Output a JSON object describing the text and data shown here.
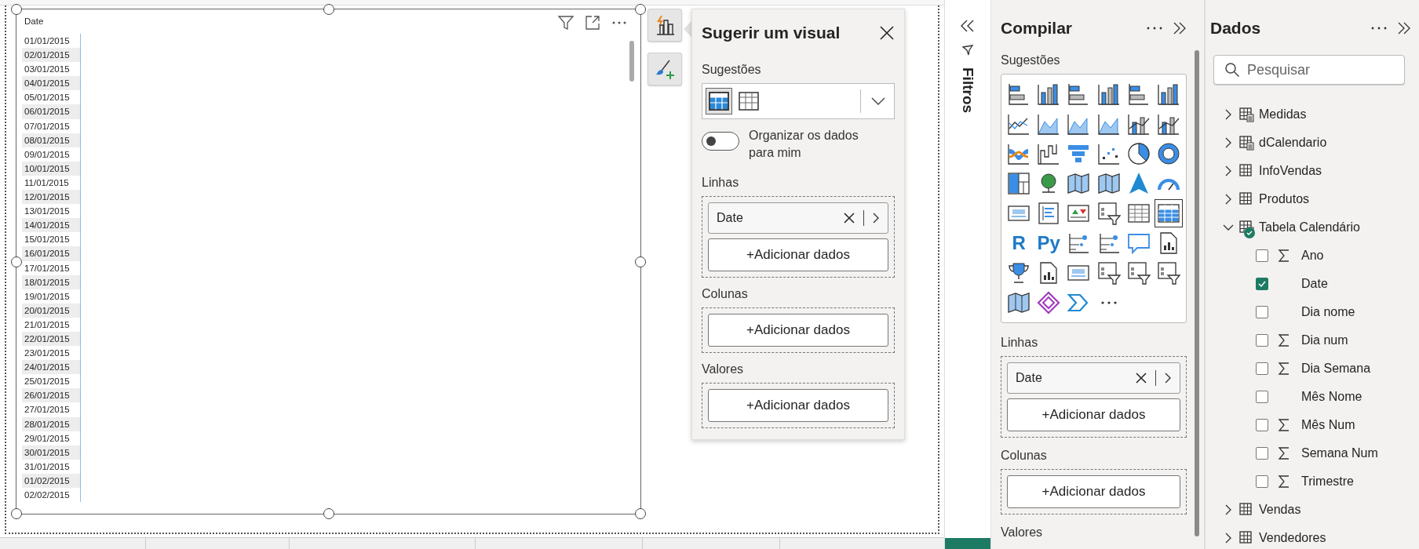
{
  "report_visual": {
    "header": "Date",
    "rows": [
      "01/01/2015",
      "02/01/2015",
      "03/01/2015",
      "04/01/2015",
      "05/01/2015",
      "06/01/2015",
      "07/01/2015",
      "08/01/2015",
      "09/01/2015",
      "10/01/2015",
      "11/01/2015",
      "12/01/2015",
      "13/01/2015",
      "14/01/2015",
      "15/01/2015",
      "16/01/2015",
      "17/01/2015",
      "18/01/2015",
      "19/01/2015",
      "20/01/2015",
      "21/01/2015",
      "22/01/2015",
      "23/01/2015",
      "24/01/2015",
      "25/01/2015",
      "26/01/2015",
      "27/01/2015",
      "28/01/2015",
      "29/01/2015",
      "30/01/2015",
      "31/01/2015",
      "01/02/2015",
      "02/02/2015"
    ]
  },
  "suggest_panel": {
    "title": "Sugerir um visual",
    "suggestions_label": "Sugestões",
    "suggestions": [
      {
        "kind": "matrix",
        "selected": true
      },
      {
        "kind": "table",
        "selected": false
      }
    ],
    "toggle": {
      "label": "Organizar os dados para mim",
      "on": false
    },
    "wells": [
      {
        "label": "Linhas",
        "fields": [
          "Date"
        ],
        "add": "+Adicionar dados"
      },
      {
        "label": "Colunas",
        "add": "+Adicionar dados"
      },
      {
        "label": "Valores",
        "add": "+Adicionar dados"
      }
    ]
  },
  "filters_pane": {
    "label": "Filtros"
  },
  "build_pane": {
    "title": "Compilar",
    "visuals_label": "Sugestões",
    "visuals": [
      {
        "kind": "hbar",
        "selected": false
      },
      {
        "kind": "column",
        "selected": false
      },
      {
        "kind": "hbar",
        "selected": false
      },
      {
        "kind": "column",
        "selected": false
      },
      {
        "kind": "hbar",
        "selected": false
      },
      {
        "kind": "column",
        "selected": false
      },
      {
        "kind": "line",
        "selected": false
      },
      {
        "kind": "area",
        "selected": false
      },
      {
        "kind": "area",
        "selected": false
      },
      {
        "kind": "area",
        "selected": false
      },
      {
        "kind": "combo",
        "selected": false
      },
      {
        "kind": "combo",
        "selected": false
      },
      {
        "kind": "ribbon",
        "selected": false
      },
      {
        "kind": "waterfall",
        "selected": false
      },
      {
        "kind": "funnel",
        "selected": false
      },
      {
        "kind": "scatter",
        "selected": false
      },
      {
        "kind": "pie",
        "selected": false
      },
      {
        "kind": "donut",
        "selected": false
      },
      {
        "kind": "treemap",
        "selected": false
      },
      {
        "kind": "globe",
        "selected": false
      },
      {
        "kind": "map",
        "selected": false
      },
      {
        "kind": "map",
        "selected": false
      },
      {
        "kind": "arrow",
        "selected": false
      },
      {
        "kind": "gauge",
        "selected": false
      },
      {
        "kind": "card",
        "selected": false
      },
      {
        "kind": "list",
        "selected": false
      },
      {
        "kind": "kpi",
        "selected": false
      },
      {
        "kind": "slicer",
        "selected": false
      },
      {
        "kind": "table",
        "selected": false
      },
      {
        "kind": "matrix",
        "selected": true
      },
      {
        "kind": "text",
        "label": "R",
        "selected": false
      },
      {
        "kind": "text",
        "label": "Py",
        "selected": false
      },
      {
        "kind": "tree",
        "selected": false
      },
      {
        "kind": "tree",
        "selected": false
      },
      {
        "kind": "bubble",
        "selected": false
      },
      {
        "kind": "doc",
        "selected": false
      },
      {
        "kind": "trophy",
        "selected": false
      },
      {
        "kind": "doc",
        "selected": false
      },
      {
        "kind": "card",
        "selected": false
      },
      {
        "kind": "slicer",
        "selected": false
      },
      {
        "kind": "slicer",
        "selected": false
      },
      {
        "kind": "slicer",
        "selected": false
      },
      {
        "kind": "map",
        "selected": false
      },
      {
        "kind": "diamond",
        "selected": false
      },
      {
        "kind": "chevron",
        "selected": false
      },
      {
        "kind": "more",
        "selected": false
      }
    ],
    "wells": [
      {
        "label": "Linhas",
        "fields": [
          "Date"
        ],
        "add": "+Adicionar dados"
      },
      {
        "label": "Colunas",
        "add": "+Adicionar dados"
      },
      {
        "label": "Valores"
      }
    ]
  },
  "data_pane": {
    "title": "Dados",
    "search": {
      "placeholder": "Pesquisar"
    },
    "tables": [
      {
        "name": "Medidas",
        "kind": "calc",
        "expanded": false,
        "used": false
      },
      {
        "name": "dCalendario",
        "kind": "calc",
        "expanded": false,
        "used": false
      },
      {
        "name": "InfoVendas",
        "kind": "table",
        "expanded": false,
        "used": false
      },
      {
        "name": "Produtos",
        "kind": "table",
        "expanded": false,
        "used": false
      },
      {
        "name": "Tabela Calendário",
        "kind": "calc",
        "expanded": true,
        "used": true,
        "children": [
          {
            "name": "Ano",
            "kind": "sum",
            "checked": false
          },
          {
            "name": "Date",
            "kind": "plain",
            "checked": true
          },
          {
            "name": "Dia nome",
            "kind": "plain",
            "checked": false
          },
          {
            "name": "Dia num",
            "kind": "sum",
            "checked": false
          },
          {
            "name": "Dia Semana",
            "kind": "sum",
            "checked": false
          },
          {
            "name": "Mês Nome",
            "kind": "plain",
            "checked": false
          },
          {
            "name": "Mês Num",
            "kind": "sum",
            "checked": false
          },
          {
            "name": "Semana Num",
            "kind": "sum",
            "checked": false
          },
          {
            "name": "Trimestre",
            "kind": "sum",
            "checked": false
          }
        ]
      },
      {
        "name": "Vendas",
        "kind": "table",
        "expanded": false,
        "used": false
      },
      {
        "name": "Vendedores",
        "kind": "table",
        "expanded": false,
        "used": false
      }
    ]
  }
}
